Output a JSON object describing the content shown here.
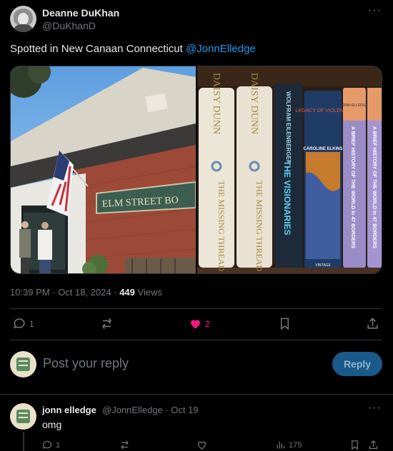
{
  "post": {
    "author_name": "Deanne DuKhan",
    "author_handle": "@DuKhanD",
    "more": "···",
    "text": "Spotted in New Canaan Connecticut ",
    "mention": "@JonnElledge",
    "timestamp": "10:39 PM · Oct 18, 2024 · ",
    "views_count": "449",
    "views_label": " Views",
    "media": {
      "left_photo": {
        "storefront_sign": "ELM STREET BO"
      },
      "right_photo": {
        "book1_author": "DAISY DUNN",
        "book1_title": "THE MISSING THREAD",
        "book2_author": "DAISY DUNN",
        "book2_title": "THE MISSING THREAD",
        "book3_author": "WOLFRAM EILENBERGER",
        "book3_title": "THE VISIONARIES",
        "book4_title": "LEGACY OF VIOLENCE",
        "book4_author": "CAROLINE ELKINS",
        "book4_publisher": "VINTAGE",
        "book5_author": "JONN ELLEDGE",
        "book5_title": "A BRIEF HISTORY OF THE WORLD in 47 BORDERS",
        "book6_title": "A BRIEF HISTORY OF THE WORLD in 47 BORDERS"
      }
    },
    "stats": {
      "replies": "1",
      "reposts": "",
      "likes": "2"
    }
  },
  "reply_box": {
    "placeholder": "Post your reply",
    "button_label": "Reply"
  },
  "comment": {
    "author_name": "jonn elledge",
    "author_handle": "@JonnElledge · Oct 19",
    "more": "···",
    "text": "omg",
    "stats": {
      "replies": "1",
      "views": "175"
    }
  },
  "colors": {
    "like": "#f91880",
    "accent": "#1d9bf0",
    "muted": "#71767b"
  }
}
